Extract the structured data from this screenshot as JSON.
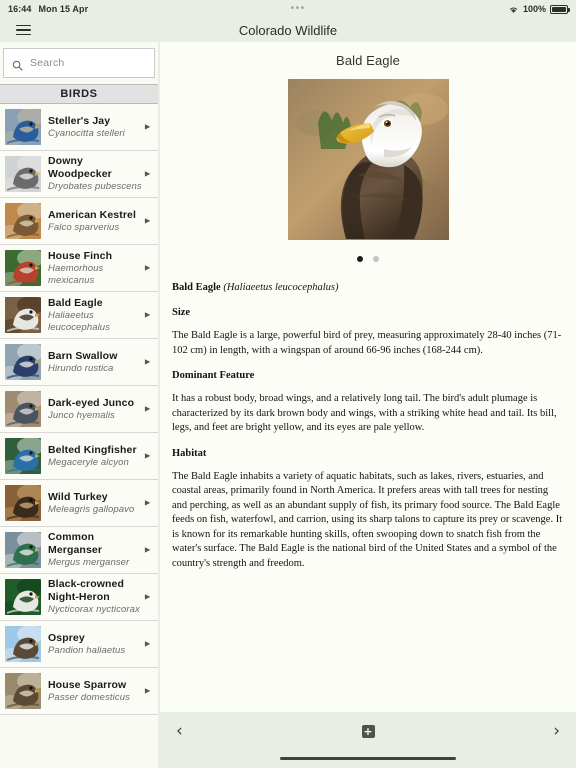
{
  "statusbar": {
    "time": "16:44",
    "date": "Mon 15 Apr",
    "center_dots": "•••",
    "battery_percent": "100%",
    "wifi_icon": "wifi-icon",
    "battery_icon": "battery-icon"
  },
  "navbar": {
    "menu_icon": "hamburger-menu-icon",
    "title": "Colorado Wildlife"
  },
  "sidebar": {
    "search": {
      "placeholder": "Search",
      "value": "",
      "icon": "search-icon"
    },
    "section_header": "BIRDS",
    "items": [
      {
        "name": "Steller's Jay",
        "sci": "Cyanocitta stelleri",
        "thumb": "bird-thumbnail-stellers-jay"
      },
      {
        "name": "Downy Woodpecker",
        "sci": "Dryobates pubescens",
        "thumb": "bird-thumbnail-downy-woodpecker"
      },
      {
        "name": "American Kestrel",
        "sci": "Falco sparverius",
        "thumb": "bird-thumbnail-american-kestrel"
      },
      {
        "name": "House Finch",
        "sci": "Haemorhous mexicanus",
        "thumb": "bird-thumbnail-house-finch"
      },
      {
        "name": "Bald Eagle",
        "sci": "Haliaeetus leucocephalus",
        "thumb": "bird-thumbnail-bald-eagle"
      },
      {
        "name": "Barn Swallow",
        "sci": "Hirundo rustica",
        "thumb": "bird-thumbnail-barn-swallow"
      },
      {
        "name": "Dark-eyed Junco",
        "sci": "Junco hyemalis",
        "thumb": "bird-thumbnail-dark-eyed-junco"
      },
      {
        "name": "Belted Kingfisher",
        "sci": "Megaceryle alcyon",
        "thumb": "bird-thumbnail-belted-kingfisher"
      },
      {
        "name": "Wild Turkey",
        "sci": "Meleagris gallopavo",
        "thumb": "bird-thumbnail-wild-turkey"
      },
      {
        "name": "Common Merganser",
        "sci": "Mergus merganser",
        "thumb": "bird-thumbnail-common-merganser"
      },
      {
        "name": "Black-crowned Night-Heron",
        "sci": "Nycticorax nycticorax",
        "thumb": "bird-thumbnail-black-crowned-night-heron"
      },
      {
        "name": "Osprey",
        "sci": "Pandion haliaetus",
        "thumb": "bird-thumbnail-osprey"
      },
      {
        "name": "House Sparrow",
        "sci": "Passer domesticus",
        "thumb": "bird-thumbnail-house-sparrow"
      }
    ],
    "row_chevron": "chevron-right-icon"
  },
  "detail": {
    "title": "Bald Eagle",
    "hero_image": "bald-eagle-photo",
    "pager": {
      "total": 2,
      "active_index": 0
    },
    "lead_name": "Bald Eagle",
    "lead_sci": "(Haliaeetus leucocephalus)",
    "sections": [
      {
        "heading": "Size",
        "body": "The Bald Eagle is a large, powerful bird of prey, measuring approximately 28-40 inches (71-102 cm) in length, with a wingspan of around 66-96 inches (168-244 cm)."
      },
      {
        "heading": "Dominant Feature",
        "body": "It has a robust body, broad wings, and a relatively long tail. The bird's adult plumage is characterized by its dark brown body and wings, with a striking white head and tail. Its bill, legs, and feet are bright yellow, and its eyes are pale yellow."
      },
      {
        "heading": "Habitat",
        "body": "The Bald Eagle inhabits a variety of aquatic habitats, such as lakes, rivers, estuaries, and coastal areas, primarily found in North America. It prefers areas with tall trees for nesting and perching, as well as an abundant supply of fish, its primary food source. The Bald Eagle feeds on fish, waterfowl, and carrion, using its sharp talons to capture its prey or scavenge. It is known for its remarkable hunting skills, often swooping down to snatch fish from the water's surface. The Bald Eagle is the national bird of the United States and a symbol of the country's strength and freedom."
      }
    ]
  },
  "toolbar": {
    "back_icon": "chevron-left-icon",
    "back_label": "‹",
    "add_label": "+",
    "add_icon": "plus-icon",
    "forward_icon": "chevron-right-icon",
    "forward_label": "›"
  },
  "colors": {
    "chrome": "#e8eee4",
    "content_bg": "#fcfdf6",
    "sidebar_bg": "#f9faf4",
    "section_header_bg": "#e2e2e2",
    "accent_dark": "#4a544a"
  }
}
